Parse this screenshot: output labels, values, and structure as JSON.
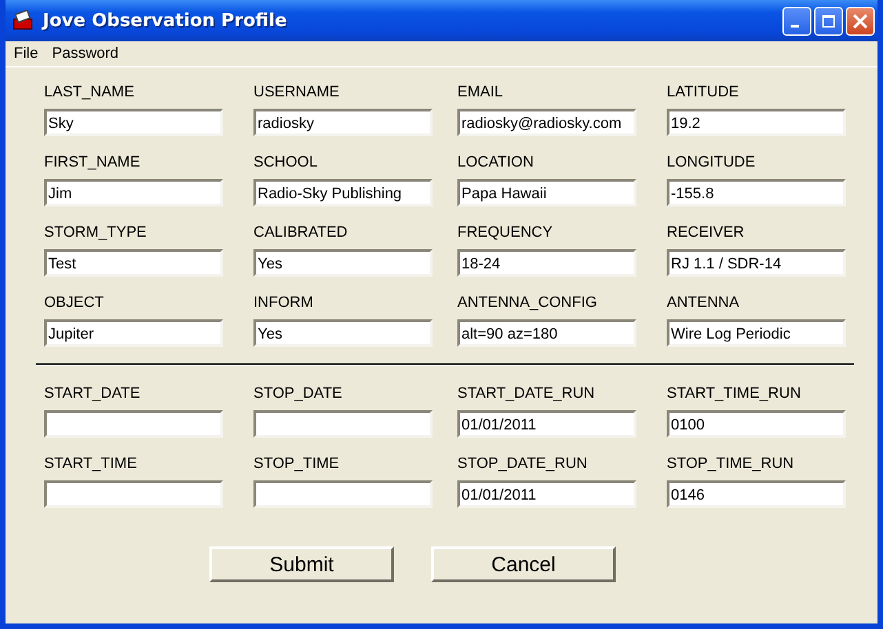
{
  "window": {
    "title": "Jove Observation Profile"
  },
  "menu": [
    "File",
    "Password"
  ],
  "sections": [
    {
      "fields": [
        {
          "label": "LAST_NAME",
          "value": "Sky"
        },
        {
          "label": "USERNAME",
          "value": "radiosky"
        },
        {
          "label": "EMAIL",
          "value": "radiosky@radiosky.com"
        },
        {
          "label": "LATITUDE",
          "value": "19.2"
        },
        {
          "label": "FIRST_NAME",
          "value": "Jim"
        },
        {
          "label": "SCHOOL",
          "value": "Radio-Sky Publishing"
        },
        {
          "label": "LOCATION",
          "value": "Papa Hawaii"
        },
        {
          "label": "LONGITUDE",
          "value": "-155.8"
        },
        {
          "label": "STORM_TYPE",
          "value": "Test"
        },
        {
          "label": "CALIBRATED",
          "value": "Yes"
        },
        {
          "label": "FREQUENCY",
          "value": "18-24"
        },
        {
          "label": "RECEIVER",
          "value": "RJ 1.1 / SDR-14"
        },
        {
          "label": "OBJECT",
          "value": "Jupiter"
        },
        {
          "label": "INFORM",
          "value": "Yes"
        },
        {
          "label": "ANTENNA_CONFIG",
          "value": "alt=90 az=180"
        },
        {
          "label": "ANTENNA",
          "value": "Wire Log Periodic"
        }
      ]
    },
    {
      "fields": [
        {
          "label": "START_DATE"
        },
        {
          "label": "STOP_DATE"
        },
        {
          "label": "START_DATE_RUN",
          "value": "01/01/2011"
        },
        {
          "label": "START_TIME_RUN",
          "value": "0100"
        },
        {
          "label": "START_TIME"
        },
        {
          "label": "STOP_TIME"
        },
        {
          "label": "STOP_DATE_RUN",
          "value": "01/01/2011"
        },
        {
          "label": "STOP_TIME_RUN",
          "value": "0146"
        }
      ]
    }
  ],
  "buttons": [
    "Submit",
    "Cancel"
  ]
}
